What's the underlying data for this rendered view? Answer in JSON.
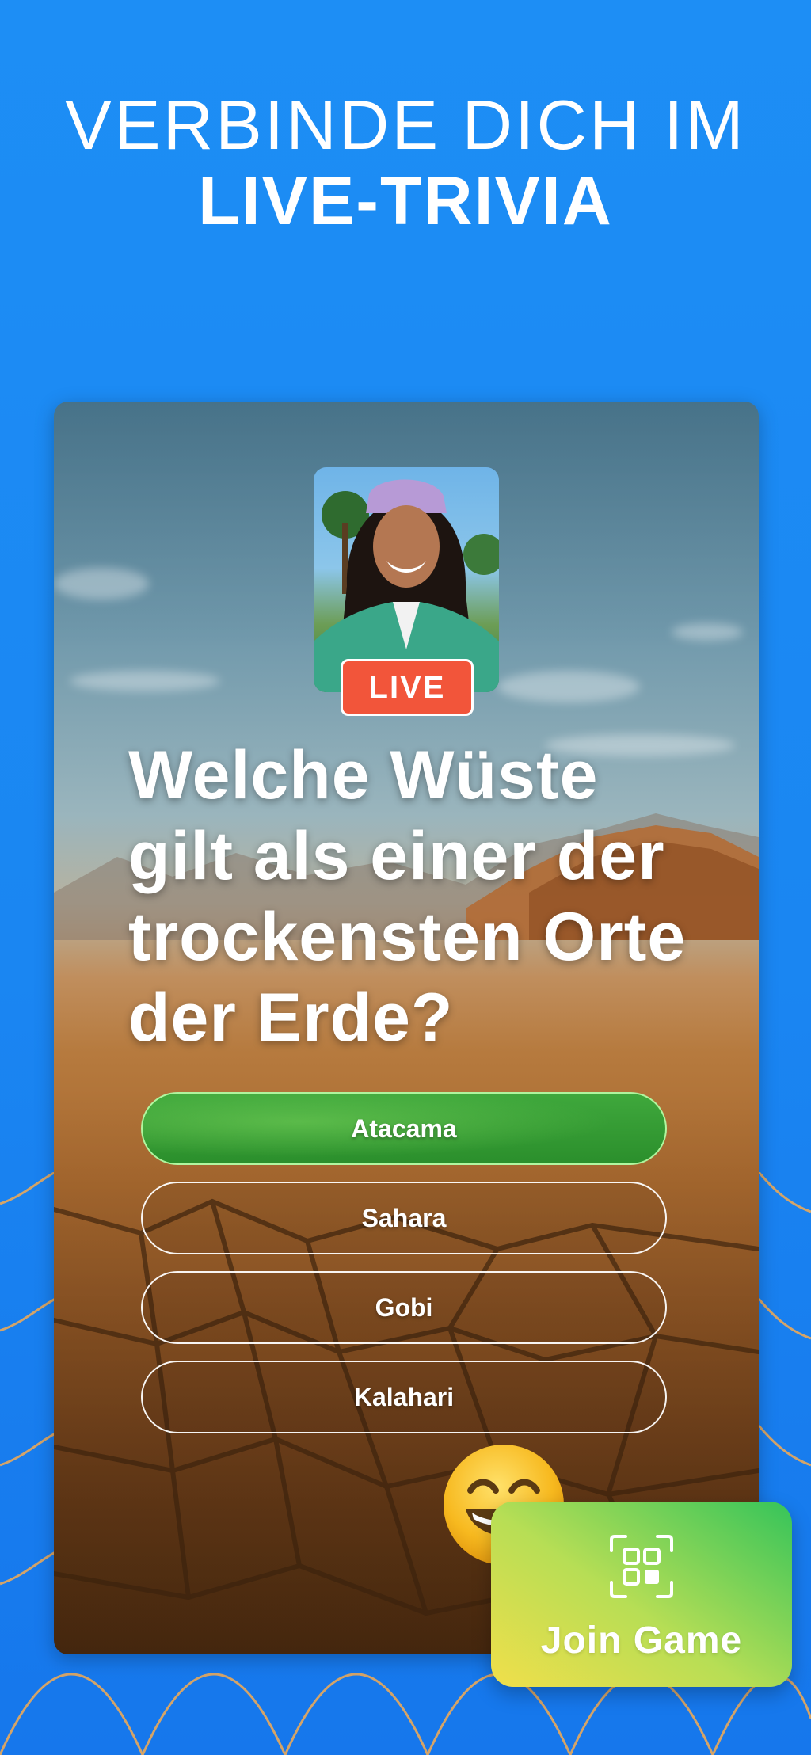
{
  "headline": {
    "line1": "VERBINDE DICH IM",
    "line2": "LIVE-TRIVIA"
  },
  "card": {
    "live_label": "LIVE",
    "question": "Welche Wüste gilt als einer der trockensten Orte der Erde?",
    "answers": [
      {
        "label": "Atacama",
        "state": "correct"
      },
      {
        "label": "Sahara",
        "state": "default"
      },
      {
        "label": "Gobi",
        "state": "default"
      },
      {
        "label": "Kalahari",
        "state": "default"
      }
    ]
  },
  "join": {
    "label": "Join Game",
    "icon": "qr-scan-icon"
  },
  "colors": {
    "background": "#1a86f2",
    "live_badge": "#f2553a",
    "correct_answer": "#2b8f2c",
    "join_gradient_start": "#f1df4a",
    "join_gradient_end": "#35c45a",
    "wave_line": "#e9a95a"
  }
}
